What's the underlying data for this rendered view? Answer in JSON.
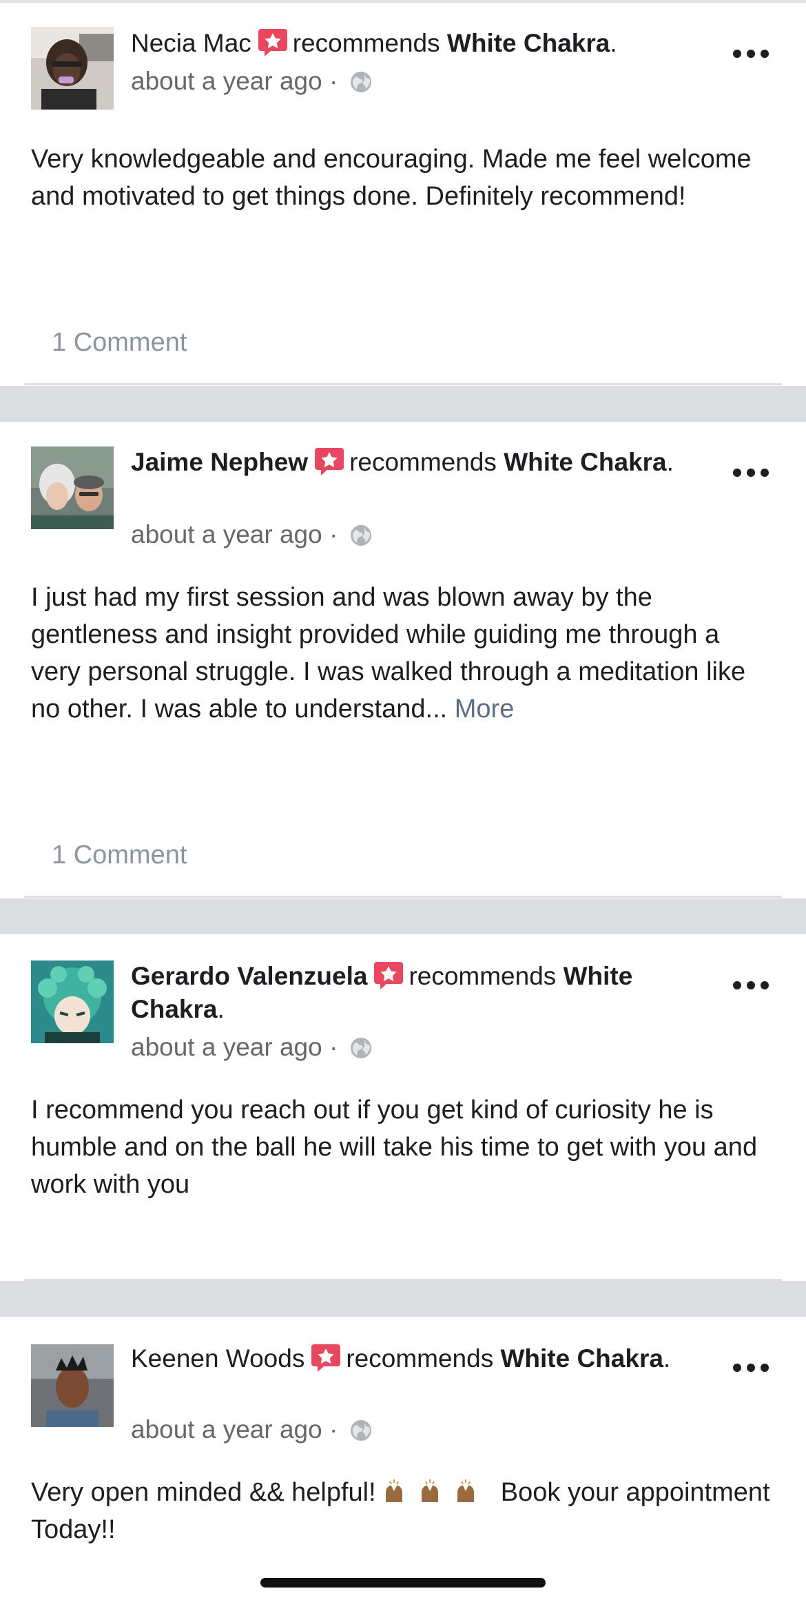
{
  "reviews": [
    {
      "reviewer": "Necia Mac",
      "verb": "recommends",
      "page": "White Chakra",
      "time": "about a year ago",
      "privacy_icon": "globe-icon",
      "text": "Very knowledgeable and encouraging. Made me feel welcome and motivated to get things done. Definitely recommend!",
      "comments": "1 Comment"
    },
    {
      "reviewer": "Jaime Nephew",
      "verb": "recommends",
      "page": "White Chakra",
      "time": "about a year ago",
      "privacy_icon": "globe-icon",
      "text": "I just had my first session and was blown away by the gentleness and insight provided while guiding me through a very personal struggle. I was walked through a meditation like no other. I was able to understand...",
      "more": "More",
      "comments": "1 Comment"
    },
    {
      "reviewer": "Gerardo Valenzuela",
      "verb": "recommends",
      "page": "White Chakra",
      "time": "about a year ago",
      "privacy_icon": "globe-icon",
      "text": "I recommend you reach out if you get kind of curiosity he is humble and on the ball he will take his time to get with you and work with you"
    },
    {
      "reviewer": "Keenen Woods",
      "verb": "recommends",
      "page": "White Chakra",
      "time": "about a year ago",
      "privacy_icon": "globe-icon",
      "text_before": "Very open minded && helpful!",
      "text_after": "Book your appointment Today!!"
    }
  ],
  "colors": {
    "recommend_badge": "#e8475f",
    "separator": "#dcdde1",
    "link": "#5b6b8a",
    "secondary_text": "#65676b"
  }
}
